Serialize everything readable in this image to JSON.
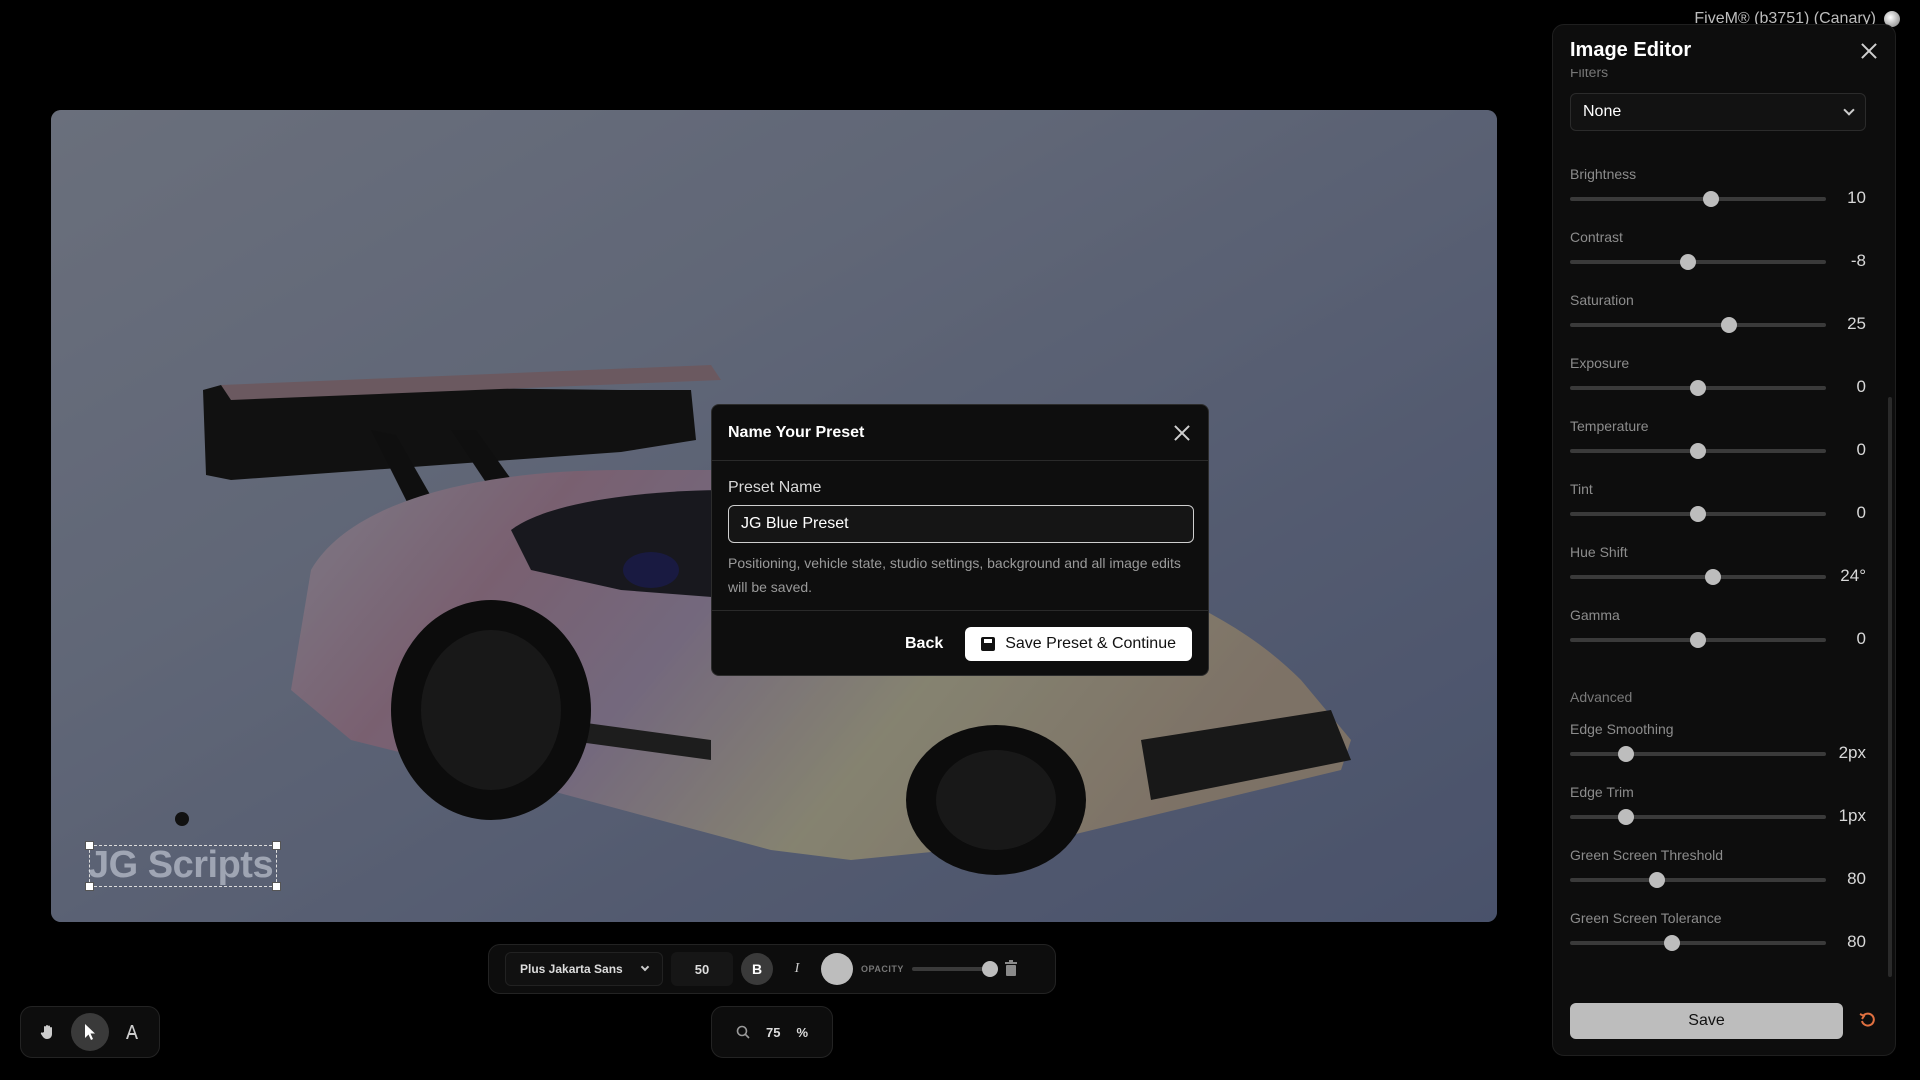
{
  "app": {
    "title": "FiveM® (b3751) (Canary)"
  },
  "canvas": {
    "watermark_text": "JG Scripts"
  },
  "dialog": {
    "title": "Name Your Preset",
    "field_label": "Preset Name",
    "field_value": "JG Blue Preset",
    "hint": "Positioning, vehicle state, studio settings, background and all image edits will be saved.",
    "back_label": "Back",
    "save_label": "Save Preset & Continue"
  },
  "panel": {
    "title": "Image Editor",
    "filters_label": "Filters",
    "filter_value": "None",
    "advanced_label": "Advanced",
    "save_label": "Save",
    "sliders": [
      {
        "label": "Brightness",
        "value": "10",
        "level": 0.55
      },
      {
        "label": "Contrast",
        "value": "-8",
        "level": 0.46
      },
      {
        "label": "Saturation",
        "value": "25",
        "level": 0.62
      },
      {
        "label": "Exposure",
        "value": "0",
        "level": 0.5
      },
      {
        "label": "Temperature",
        "value": "0",
        "level": 0.5
      },
      {
        "label": "Tint",
        "value": "0",
        "level": 0.5
      },
      {
        "label": "Hue Shift",
        "value": "24°",
        "level": 0.56
      },
      {
        "label": "Gamma",
        "value": "0",
        "level": 0.5
      }
    ],
    "advanced_sliders": [
      {
        "label": "Edge Smoothing",
        "value": "2px",
        "level": 0.22
      },
      {
        "label": "Edge Trim",
        "value": "1px",
        "level": 0.22
      },
      {
        "label": "Green Screen Threshold",
        "value": "80",
        "level": 0.34
      },
      {
        "label": "Green Screen Tolerance",
        "value": "80",
        "level": 0.4
      }
    ]
  },
  "text_toolbar": {
    "font": "Plus Jakarta Sans",
    "size": "50",
    "bold_label": "B",
    "italic_label": "I",
    "opacity_label": "OPACITY",
    "opacity_level": 1.0
  },
  "zoom": {
    "value": "75",
    "unit": "%"
  },
  "tools": [
    "hand-icon",
    "pointer-icon",
    "text-icon"
  ]
}
